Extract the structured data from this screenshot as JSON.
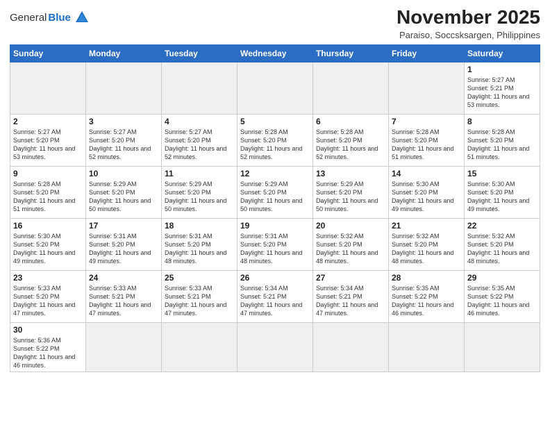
{
  "header": {
    "logo_general": "General",
    "logo_blue": "Blue",
    "month_title": "November 2025",
    "location": "Paraiso, Soccsksargen, Philippines"
  },
  "weekdays": [
    "Sunday",
    "Monday",
    "Tuesday",
    "Wednesday",
    "Thursday",
    "Friday",
    "Saturday"
  ],
  "weeks": [
    [
      {
        "day": "",
        "empty": true
      },
      {
        "day": "",
        "empty": true
      },
      {
        "day": "",
        "empty": true
      },
      {
        "day": "",
        "empty": true
      },
      {
        "day": "",
        "empty": true
      },
      {
        "day": "",
        "empty": true
      },
      {
        "day": "1",
        "sunrise": "Sunrise: 5:27 AM",
        "sunset": "Sunset: 5:21 PM",
        "daylight": "Daylight: 11 hours and 53 minutes."
      }
    ],
    [
      {
        "day": "2",
        "sunrise": "Sunrise: 5:27 AM",
        "sunset": "Sunset: 5:20 PM",
        "daylight": "Daylight: 11 hours and 53 minutes."
      },
      {
        "day": "3",
        "sunrise": "Sunrise: 5:27 AM",
        "sunset": "Sunset: 5:20 PM",
        "daylight": "Daylight: 11 hours and 52 minutes."
      },
      {
        "day": "4",
        "sunrise": "Sunrise: 5:27 AM",
        "sunset": "Sunset: 5:20 PM",
        "daylight": "Daylight: 11 hours and 52 minutes."
      },
      {
        "day": "5",
        "sunrise": "Sunrise: 5:28 AM",
        "sunset": "Sunset: 5:20 PM",
        "daylight": "Daylight: 11 hours and 52 minutes."
      },
      {
        "day": "6",
        "sunrise": "Sunrise: 5:28 AM",
        "sunset": "Sunset: 5:20 PM",
        "daylight": "Daylight: 11 hours and 52 minutes."
      },
      {
        "day": "7",
        "sunrise": "Sunrise: 5:28 AM",
        "sunset": "Sunset: 5:20 PM",
        "daylight": "Daylight: 11 hours and 51 minutes."
      },
      {
        "day": "8",
        "sunrise": "Sunrise: 5:28 AM",
        "sunset": "Sunset: 5:20 PM",
        "daylight": "Daylight: 11 hours and 51 minutes."
      }
    ],
    [
      {
        "day": "9",
        "sunrise": "Sunrise: 5:28 AM",
        "sunset": "Sunset: 5:20 PM",
        "daylight": "Daylight: 11 hours and 51 minutes."
      },
      {
        "day": "10",
        "sunrise": "Sunrise: 5:29 AM",
        "sunset": "Sunset: 5:20 PM",
        "daylight": "Daylight: 11 hours and 50 minutes."
      },
      {
        "day": "11",
        "sunrise": "Sunrise: 5:29 AM",
        "sunset": "Sunset: 5:20 PM",
        "daylight": "Daylight: 11 hours and 50 minutes."
      },
      {
        "day": "12",
        "sunrise": "Sunrise: 5:29 AM",
        "sunset": "Sunset: 5:20 PM",
        "daylight": "Daylight: 11 hours and 50 minutes."
      },
      {
        "day": "13",
        "sunrise": "Sunrise: 5:29 AM",
        "sunset": "Sunset: 5:20 PM",
        "daylight": "Daylight: 11 hours and 50 minutes."
      },
      {
        "day": "14",
        "sunrise": "Sunrise: 5:30 AM",
        "sunset": "Sunset: 5:20 PM",
        "daylight": "Daylight: 11 hours and 49 minutes."
      },
      {
        "day": "15",
        "sunrise": "Sunrise: 5:30 AM",
        "sunset": "Sunset: 5:20 PM",
        "daylight": "Daylight: 11 hours and 49 minutes."
      }
    ],
    [
      {
        "day": "16",
        "sunrise": "Sunrise: 5:30 AM",
        "sunset": "Sunset: 5:20 PM",
        "daylight": "Daylight: 11 hours and 49 minutes."
      },
      {
        "day": "17",
        "sunrise": "Sunrise: 5:31 AM",
        "sunset": "Sunset: 5:20 PM",
        "daylight": "Daylight: 11 hours and 49 minutes."
      },
      {
        "day": "18",
        "sunrise": "Sunrise: 5:31 AM",
        "sunset": "Sunset: 5:20 PM",
        "daylight": "Daylight: 11 hours and 48 minutes."
      },
      {
        "day": "19",
        "sunrise": "Sunrise: 5:31 AM",
        "sunset": "Sunset: 5:20 PM",
        "daylight": "Daylight: 11 hours and 48 minutes."
      },
      {
        "day": "20",
        "sunrise": "Sunrise: 5:32 AM",
        "sunset": "Sunset: 5:20 PM",
        "daylight": "Daylight: 11 hours and 48 minutes."
      },
      {
        "day": "21",
        "sunrise": "Sunrise: 5:32 AM",
        "sunset": "Sunset: 5:20 PM",
        "daylight": "Daylight: 11 hours and 48 minutes."
      },
      {
        "day": "22",
        "sunrise": "Sunrise: 5:32 AM",
        "sunset": "Sunset: 5:20 PM",
        "daylight": "Daylight: 11 hours and 48 minutes."
      }
    ],
    [
      {
        "day": "23",
        "sunrise": "Sunrise: 5:33 AM",
        "sunset": "Sunset: 5:20 PM",
        "daylight": "Daylight: 11 hours and 47 minutes."
      },
      {
        "day": "24",
        "sunrise": "Sunrise: 5:33 AM",
        "sunset": "Sunset: 5:21 PM",
        "daylight": "Daylight: 11 hours and 47 minutes."
      },
      {
        "day": "25",
        "sunrise": "Sunrise: 5:33 AM",
        "sunset": "Sunset: 5:21 PM",
        "daylight": "Daylight: 11 hours and 47 minutes."
      },
      {
        "day": "26",
        "sunrise": "Sunrise: 5:34 AM",
        "sunset": "Sunset: 5:21 PM",
        "daylight": "Daylight: 11 hours and 47 minutes."
      },
      {
        "day": "27",
        "sunrise": "Sunrise: 5:34 AM",
        "sunset": "Sunset: 5:21 PM",
        "daylight": "Daylight: 11 hours and 47 minutes."
      },
      {
        "day": "28",
        "sunrise": "Sunrise: 5:35 AM",
        "sunset": "Sunset: 5:22 PM",
        "daylight": "Daylight: 11 hours and 46 minutes."
      },
      {
        "day": "29",
        "sunrise": "Sunrise: 5:35 AM",
        "sunset": "Sunset: 5:22 PM",
        "daylight": "Daylight: 11 hours and 46 minutes."
      }
    ],
    [
      {
        "day": "30",
        "sunrise": "Sunrise: 5:36 AM",
        "sunset": "Sunset: 5:22 PM",
        "daylight": "Daylight: 11 hours and 46 minutes."
      },
      {
        "day": "",
        "empty": true
      },
      {
        "day": "",
        "empty": true
      },
      {
        "day": "",
        "empty": true
      },
      {
        "day": "",
        "empty": true
      },
      {
        "day": "",
        "empty": true
      },
      {
        "day": "",
        "empty": true
      }
    ]
  ]
}
